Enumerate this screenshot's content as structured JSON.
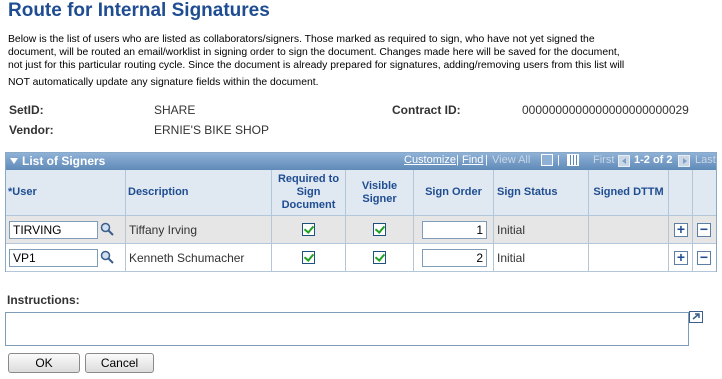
{
  "page": {
    "title": "Route for Internal Signatures",
    "description_lines": [
      "Below is the list of users who are listed as collaborators/signers. Those marked as required to sign, who have not yet signed the",
      "document, will be routed an email/worklist in signing order to sign the document. Changes made here will be saved for the document,",
      "not just for this particular routing cycle. Since the document is already prepared for signatures, adding/removing users from this list will",
      "NOT automatically update any signature fields within the document."
    ]
  },
  "fields": {
    "setid_label": "SetID:",
    "setid_value": "SHARE",
    "contract_label": "Contract ID:",
    "contract_value": "0000000000000000000000029",
    "vendor_label": "Vendor:",
    "vendor_value": "ERNIE'S BIKE SHOP"
  },
  "grid": {
    "title": "List of Signers",
    "customize": "Customize",
    "separator": "|",
    "find": "Find",
    "view_all": "View All",
    "first": "First",
    "range": "1-2 of 2",
    "last": "Last",
    "columns": {
      "user": "*User",
      "description": "Description",
      "required": "Required to Sign Document",
      "visible": "Visible Signer",
      "order": "Sign Order",
      "status": "Sign Status",
      "dttm": "Signed DTTM"
    },
    "rows": [
      {
        "user": "TIRVING",
        "description": "Tiffany Irving",
        "required": true,
        "visible": true,
        "order": "1",
        "status": "Initial",
        "dttm": ""
      },
      {
        "user": "VP1",
        "description": "Kenneth Schumacher",
        "required": true,
        "visible": true,
        "order": "2",
        "status": "Initial",
        "dttm": ""
      }
    ],
    "add_symbol": "+",
    "remove_symbol": "−"
  },
  "instructions": {
    "label": "Instructions:",
    "value": ""
  },
  "buttons": {
    "ok": "OK",
    "cancel": "Cancel"
  },
  "colors": {
    "title": "#1f4d92",
    "grid_header": "#5f8ab8",
    "row_alt": "#e6e6e6",
    "check": "#21a121"
  },
  "icons": [
    "search-icon",
    "zoom-icon",
    "download-grid-icon",
    "first-arrow-icon",
    "next-arrow-icon",
    "add-row-icon",
    "delete-row-icon",
    "expand-text-icon"
  ]
}
